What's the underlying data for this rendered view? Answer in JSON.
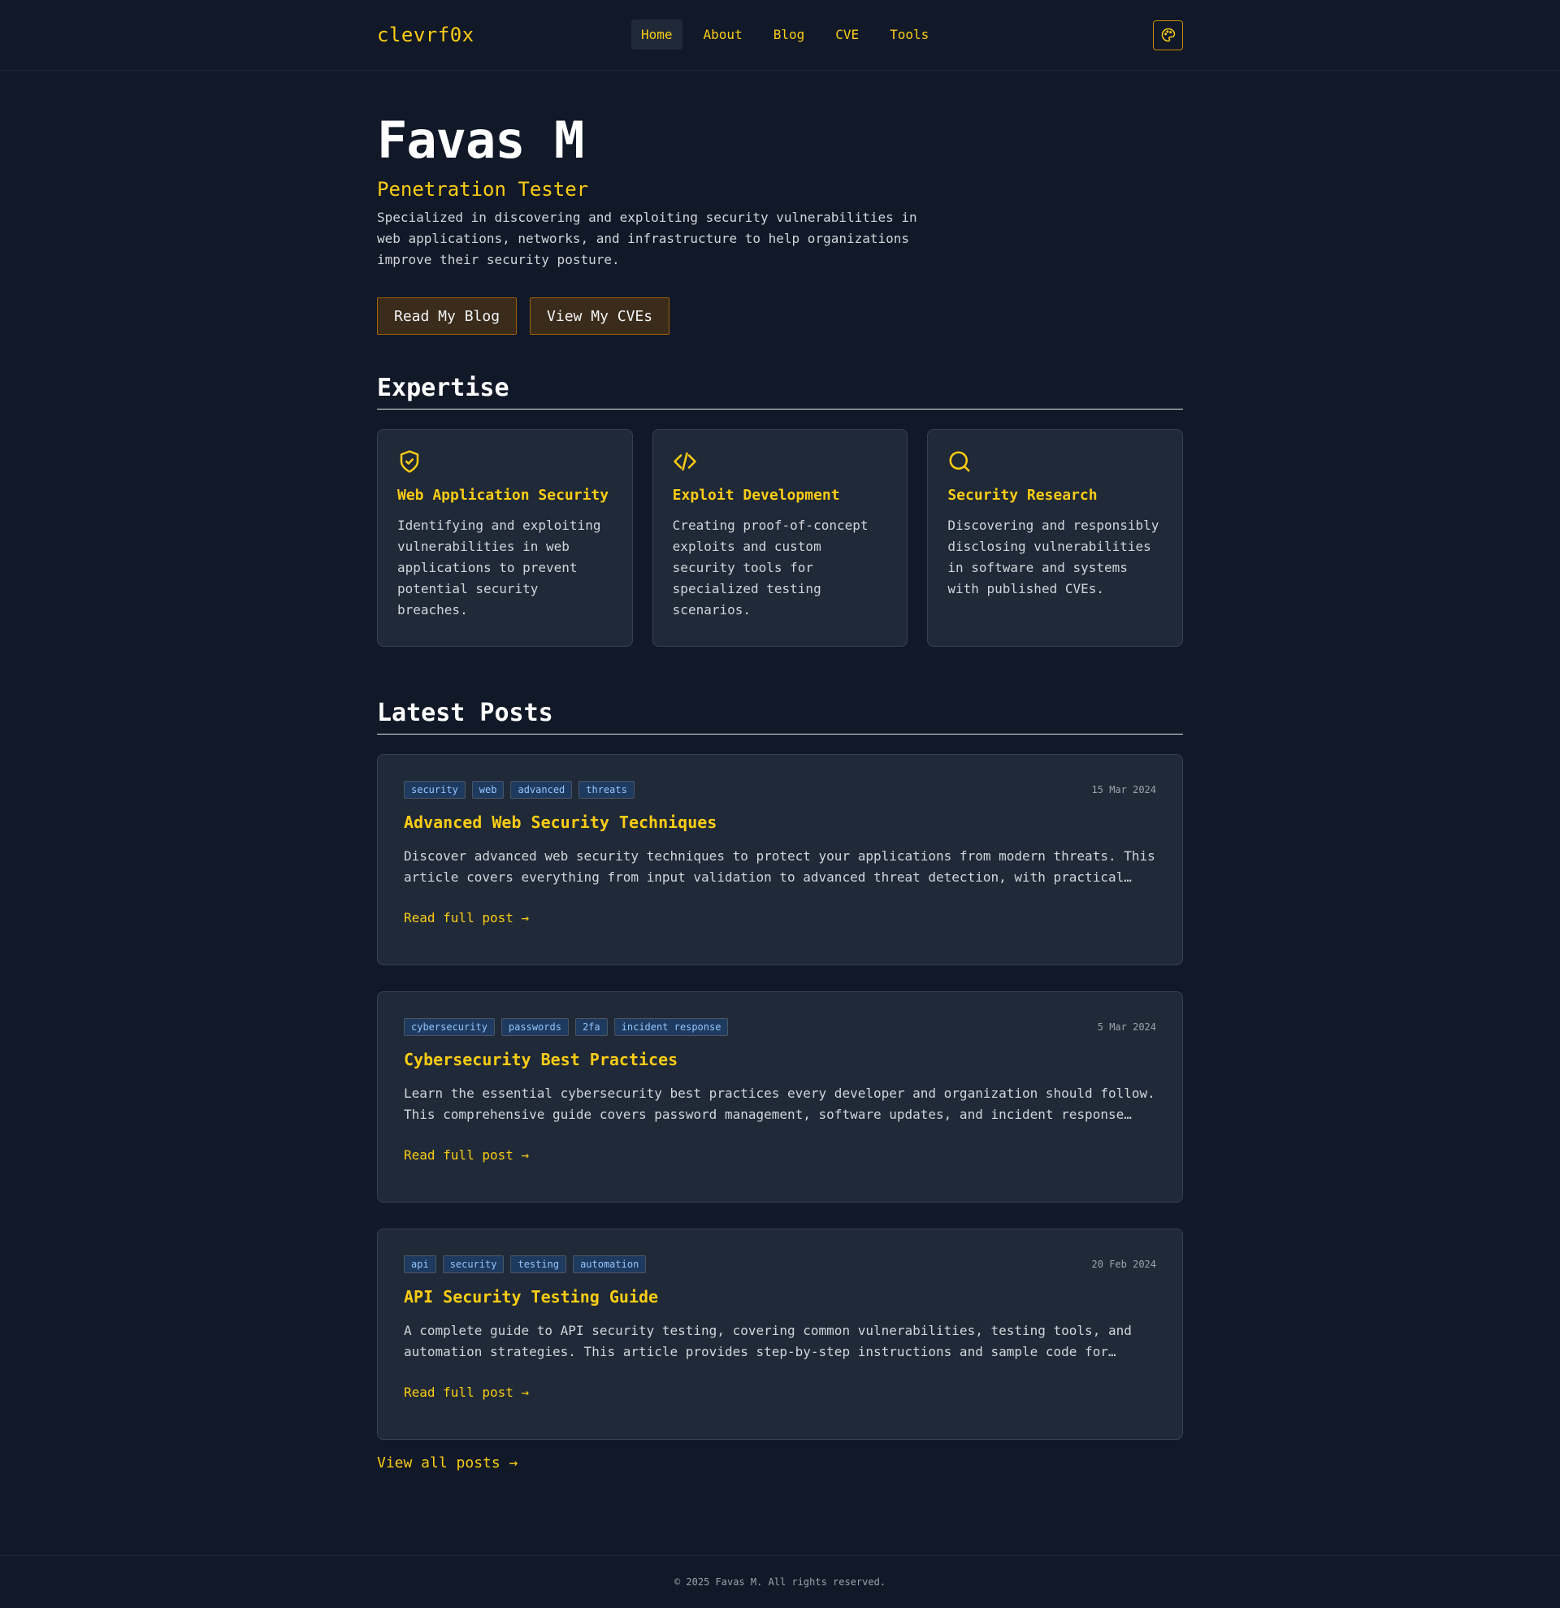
{
  "brand": "clevrf0x",
  "nav": {
    "items": [
      {
        "label": "Home",
        "active": true
      },
      {
        "label": "About",
        "active": false
      },
      {
        "label": "Blog",
        "active": false
      },
      {
        "label": "CVE",
        "active": false
      },
      {
        "label": "Tools",
        "active": false
      }
    ],
    "theme_icon": "palette-icon"
  },
  "hero": {
    "name": "Favas M",
    "role": "Penetration Tester",
    "description": "Specialized in discovering and exploiting security vulnerabilities in web applications, networks, and infrastructure to help organizations improve their security posture.",
    "buttons": [
      "Read My Blog",
      "View My CVEs"
    ]
  },
  "expertise": {
    "title": "Expertise",
    "cards": [
      {
        "icon": "shield-check-icon",
        "title": "Web Application Security",
        "text": "Identifying and exploiting vulnerabilities in web applications to prevent potential security breaches."
      },
      {
        "icon": "code-icon",
        "title": "Exploit Development",
        "text": "Creating proof-of-concept exploits and custom security tools for specialized testing scenarios."
      },
      {
        "icon": "search-icon",
        "title": "Security Research",
        "text": "Discovering and responsibly disclosing vulnerabilities in software and systems with published CVEs."
      }
    ]
  },
  "posts": {
    "title": "Latest Posts",
    "items": [
      {
        "tags": [
          "security",
          "web",
          "advanced",
          "threats"
        ],
        "date": "15 Mar 2024",
        "title": "Advanced Web Security Techniques",
        "excerpt": "Discover advanced web security techniques to protect your applications from modern threats. This article covers everything from input validation to advanced threat detection, with practical…",
        "read_more": "Read full post →"
      },
      {
        "tags": [
          "cybersecurity",
          "passwords",
          "2fa",
          "incident response"
        ],
        "date": "5 Mar 2024",
        "title": "Cybersecurity Best Practices",
        "excerpt": "Learn the essential cybersecurity best practices every developer and organization should follow. This comprehensive guide covers password management, software updates, and incident response…",
        "read_more": "Read full post →"
      },
      {
        "tags": [
          "api",
          "security",
          "testing",
          "automation"
        ],
        "date": "20 Feb 2024",
        "title": "API Security Testing Guide",
        "excerpt": "A complete guide to API security testing, covering common vulnerabilities, testing tools, and automation strategies. This article provides step-by-step instructions and sample code for…",
        "read_more": "Read full post →"
      }
    ],
    "view_all": "View all posts →"
  },
  "footer": {
    "text": "© 2025 Favas M. All rights reserved."
  },
  "colors": {
    "background": "#111827",
    "card": "#1f2937",
    "accent": "#facc15",
    "tag_text": "#93c5fd"
  }
}
